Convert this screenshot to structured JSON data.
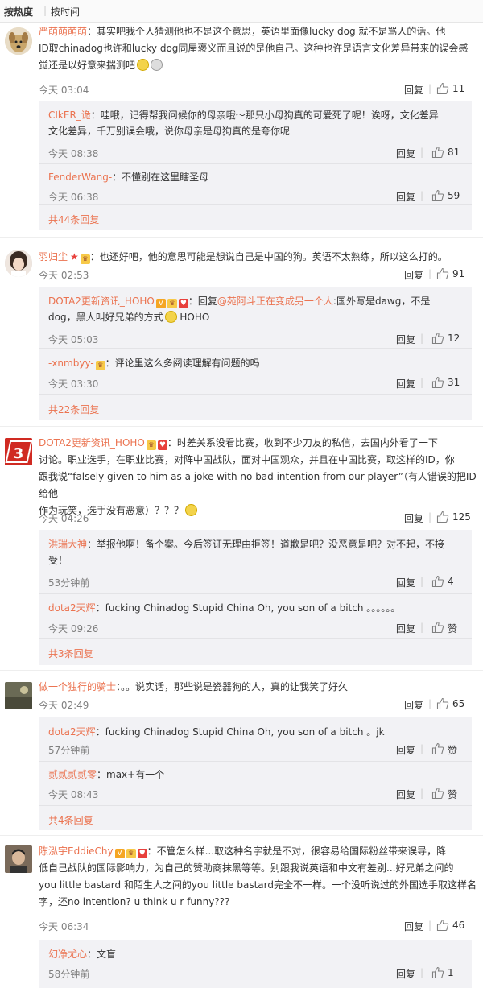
{
  "sort": {
    "hot": "按热度",
    "time": "按时间",
    "sep": "|"
  },
  "ui": {
    "reply": "回复",
    "sep": "|"
  },
  "colors": {
    "link": "#eb7350",
    "subbg": "#f2f2f5"
  },
  "comments": [
    {
      "user": "严萌萌萌萌",
      "body1": "：其实吧我个人猜测他也不是这个意思，英语里面像lucky dog 就不是骂人的话。他",
      "body2": "ID取chinadog也许和lucky dog同屋褒义而且说的是他自己。这种也许是语言文化差异带来的误会感",
      "body3": "觉还是以好意来揣测吧",
      "time": "今天 03:04",
      "likes": "11",
      "replies": [
        {
          "user": "CIkER_诡",
          "body1": "：哇哦，记得帮我问候你的母亲哦～那只小母狗真的可爱死了呢！诶呀，文化差异",
          "body2": "文化差异，千万别误会哦，说你母亲是母狗真的是夸你呢",
          "time": "今天 08:38",
          "likes": "81"
        },
        {
          "user": "FenderWang-",
          "body1": "：不懂别在这里瞎圣母",
          "time": "今天 06:38",
          "likes": "59"
        }
      ],
      "more": "共44条回复"
    },
    {
      "user": "羽归尘",
      "body1": "：也还好吧，他的意思可能是想说自己是中国的狗。英语不太熟练，所以这么打的。",
      "time": "今天 02:53",
      "likes": "91",
      "replies": [
        {
          "user": "DOTA2更新资讯_HOHO",
          "prefix": "：回复",
          "at": "@苑阿斗正在变成另一个人",
          "body1": ":国外写是dawg，不是",
          "body2": "dog，黑人叫好兄弟的方式",
          "body2b": " HOHO",
          "time": "今天 05:03",
          "likes": "12"
        },
        {
          "user": "-xnmbyy-",
          "body1": "：评论里这么多阅读理解有问题的吗",
          "time": "今天 03:30",
          "likes": "31"
        }
      ],
      "more": "共22条回复"
    },
    {
      "user": "DOTA2更新资讯_HOHO",
      "body1": "：时差关系没看比赛，收到不少刀友的私信，去国内外看了一下",
      "body2": "讨论。职业选手，在职业比赛，对阵中国战队，面对中国观众，并且在中国比赛，取这样的ID，你",
      "body3": "跟我说“falsely given to him as a joke with no bad intention from our player”（有人错误的把ID给他",
      "body4": "作为玩笑，选手没有恶意）？？？",
      "time": "今天 04:26",
      "likes": "125",
      "replies": [
        {
          "user": "洪瑞大神",
          "body1": "：举报他啊！备个案。今后签证无理由拒签！道歉是吧？没恶意是吧？对不起，不接",
          "body2": "受！",
          "time": "53分钟前",
          "likes": "4"
        },
        {
          "user": "dota2天辉",
          "body1": "：fucking Chinadog Stupid China Oh, you son of a bitch 。。。。。。",
          "time": "今天 09:26",
          "likes": "赞"
        }
      ],
      "more": "共3条回复"
    },
    {
      "user": "做一个独行的骑士",
      "body1": "：。。说实话，那些说是瓷器狗的人，真的让我笑了好久",
      "time": "今天 02:49",
      "likes": "65",
      "replies": [
        {
          "user": "dota2天辉",
          "body1": "：fucking Chinadog Stupid China Oh, you son of a bitch 。jk",
          "time": "57分钟前",
          "likes": "赞"
        },
        {
          "user": "贰贰贰贰零",
          "body1": "：max+有一个",
          "time": "今天 08:43",
          "likes": "赞"
        }
      ],
      "more": "共4条回复"
    },
    {
      "user": "陈泓宇EddieChy",
      "body1": "：不管怎么样...取这种名字就是不对，很容易给国际粉丝带来误导，降",
      "body2": "低自己战队的国际影响力，为自己的赞助商抹黑等等。别跟我说英语和中文有差别...好兄弟之间的",
      "body3": "you little bastard 和陌生人之间的you little bastard完全不一样。一个没听说过的外国选手取这样名",
      "body4": "字，还no intention? u think u r funny???",
      "time": "今天 06:34",
      "likes": "46",
      "replies": [
        {
          "user": "幻净尤心",
          "body1": "：文盲",
          "time": "58分钟前",
          "likes": "1"
        }
      ]
    }
  ]
}
